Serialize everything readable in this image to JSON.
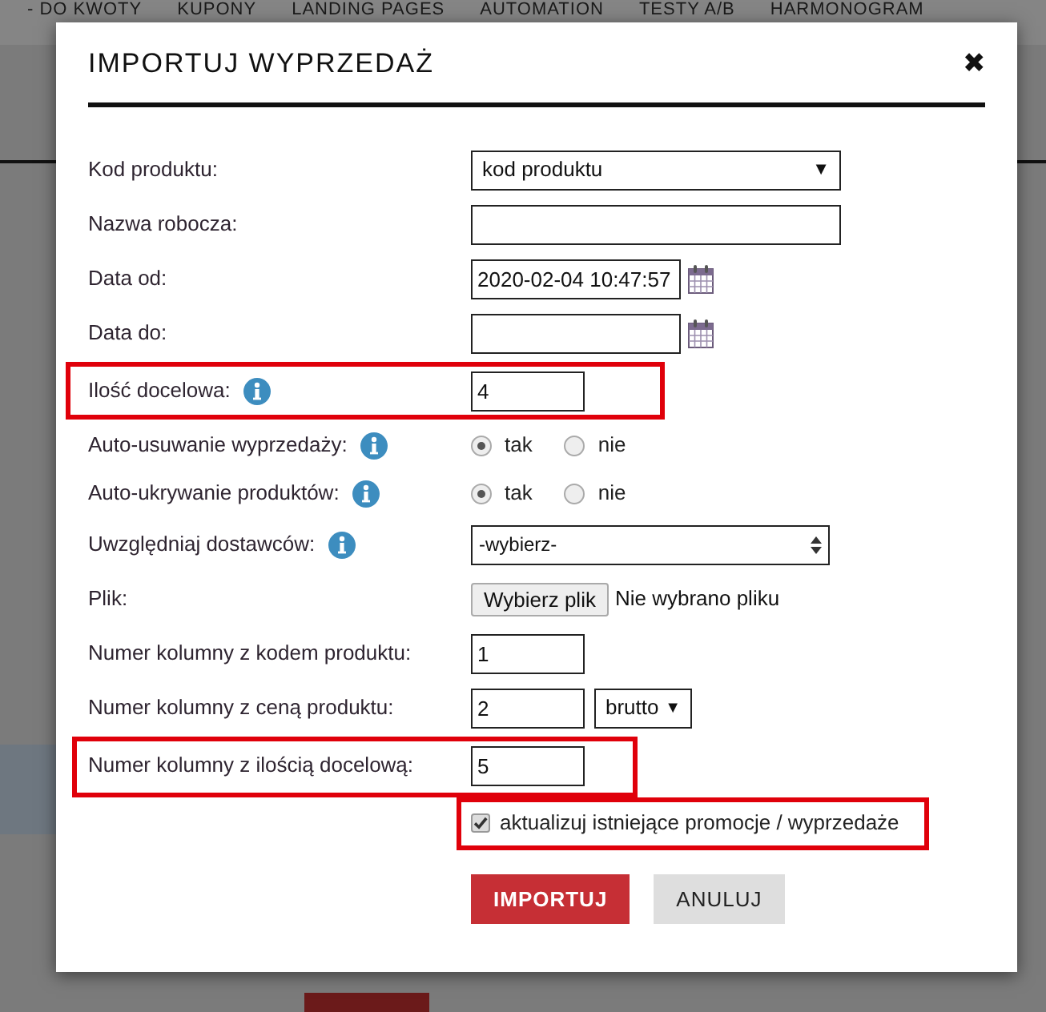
{
  "nav": [
    "- DO KWOTY",
    "KUPONY",
    "LANDING PAGES",
    "AUTOMATION",
    "TESTY A/B",
    "HARMONOGRAM"
  ],
  "dialog": {
    "title": "IMPORTUJ WYPRZEDAŻ",
    "close": "✖",
    "rows": [
      {
        "kind": "select",
        "label": "Kod produktu:",
        "value": "kod produktu",
        "caret": "▼",
        "highlighted": false
      },
      {
        "kind": "text",
        "label": "Nazwa robocza:",
        "highlighted": false
      },
      {
        "kind": "date",
        "label": "Data od:",
        "value": "2020-02-04 10:47:57",
        "highlighted": false
      },
      {
        "kind": "date",
        "label": "Data do:",
        "highlighted": false
      },
      {
        "kind": "number",
        "label": "Ilość docelowa:",
        "info": true,
        "value": "4",
        "highlighted": true
      },
      {
        "kind": "radio",
        "label": "Auto-usuwanie wyprzedaży:",
        "info": true,
        "options": [
          {
            "label": "tak",
            "selected": true
          },
          {
            "label": "nie",
            "selected": false
          }
        ],
        "highlighted": false
      },
      {
        "kind": "radio",
        "label": "Auto-ukrywanie produktów:",
        "info": true,
        "options": [
          {
            "label": "tak",
            "selected": true
          },
          {
            "label": "nie",
            "selected": false
          }
        ],
        "highlighted": false
      },
      {
        "kind": "spinner",
        "label": "Uwzględniaj dostawców:",
        "info": true,
        "value": "-wybierz-",
        "highlighted": false
      },
      {
        "kind": "file",
        "label": "Plik:",
        "button": "Wybierz plik",
        "status": "Nie wybrano pliku",
        "highlighted": false
      },
      {
        "kind": "number",
        "label": "Numer kolumny z kodem produktu:",
        "value": "1",
        "highlighted": false
      },
      {
        "kind": "number_select",
        "label": "Numer kolumny z ceną produktu:",
        "value": "2",
        "unit": "brutto",
        "caret": "▼",
        "highlighted": false
      },
      {
        "kind": "number",
        "label": "Numer kolumny z ilością docelową:",
        "value": "5",
        "highlighted": true
      }
    ],
    "checkbox": {
      "label": "aktualizuj istniejące promocje / wyprzedaże",
      "checked": true,
      "highlighted": true
    },
    "buttons": [
      {
        "label": "IMPORTUJ",
        "kind": "primary"
      },
      {
        "label": "ANULUJ",
        "kind": "secondary"
      }
    ]
  }
}
